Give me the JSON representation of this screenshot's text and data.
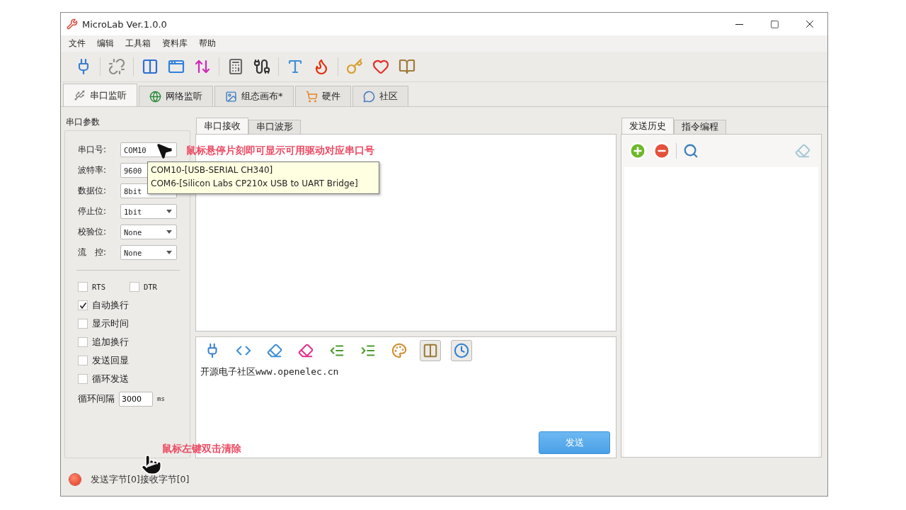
{
  "window": {
    "title": "MicroLab Ver.1.0.0"
  },
  "menu": [
    "文件",
    "编辑",
    "工具箱",
    "资料库",
    "帮助"
  ],
  "main_tabs": [
    {
      "label": "串口监听",
      "selected": true
    },
    {
      "label": "网络监听",
      "selected": false
    },
    {
      "label": "组态画布*",
      "selected": false
    },
    {
      "label": "硬件",
      "selected": false
    },
    {
      "label": "社区",
      "selected": false
    }
  ],
  "serial_params": {
    "title": "串口参数",
    "fields": [
      {
        "label": "串口号:",
        "value": "COM10"
      },
      {
        "label": "波特率:",
        "value": "9600"
      },
      {
        "label": "数据位:",
        "value": "8bit"
      },
      {
        "label": "停止位:",
        "value": "1bit"
      },
      {
        "label": "校验位:",
        "value": "None"
      },
      {
        "label": "流　控:",
        "value": "None"
      }
    ],
    "lines": [
      {
        "label": "RTS",
        "checked": false
      },
      {
        "label": "DTR",
        "checked": false
      }
    ],
    "options": [
      {
        "label": "自动换行",
        "checked": true
      },
      {
        "label": "显示时间",
        "checked": false
      },
      {
        "label": "追加换行",
        "checked": false
      },
      {
        "label": "发送回显",
        "checked": false
      },
      {
        "label": "循环发送",
        "checked": false
      }
    ],
    "interval": {
      "label": "循环间隔",
      "value": "3000",
      "unit": "ms"
    }
  },
  "tooltip": {
    "lines": [
      "COM10-[USB-SERIAL CH340]",
      "COM6-[Silicon Labs CP210x USB to UART Bridge]"
    ]
  },
  "hover_note": "鼠标悬停片刻即可显示可用驱动对应串口号",
  "clear_note": "鼠标左键双击清除",
  "receive_tabs": [
    {
      "label": "串口接收",
      "selected": true
    },
    {
      "label": "串口波形",
      "selected": false
    }
  ],
  "send_tools": [
    {
      "pressed": false
    },
    {
      "pressed": false
    },
    {
      "pressed": false
    },
    {
      "pressed": false
    },
    {
      "pressed": false
    },
    {
      "pressed": false
    },
    {
      "pressed": false
    },
    {
      "pressed": true
    },
    {
      "pressed": true
    }
  ],
  "send_text": "开源电子社区www.openelec.cn",
  "send_button": "发送",
  "history_tabs": [
    {
      "label": "发送历史",
      "selected": true
    },
    {
      "label": "指令编程",
      "selected": false
    }
  ],
  "status": {
    "sent": "发送字节[0]",
    "received": "接收字节[0]"
  }
}
